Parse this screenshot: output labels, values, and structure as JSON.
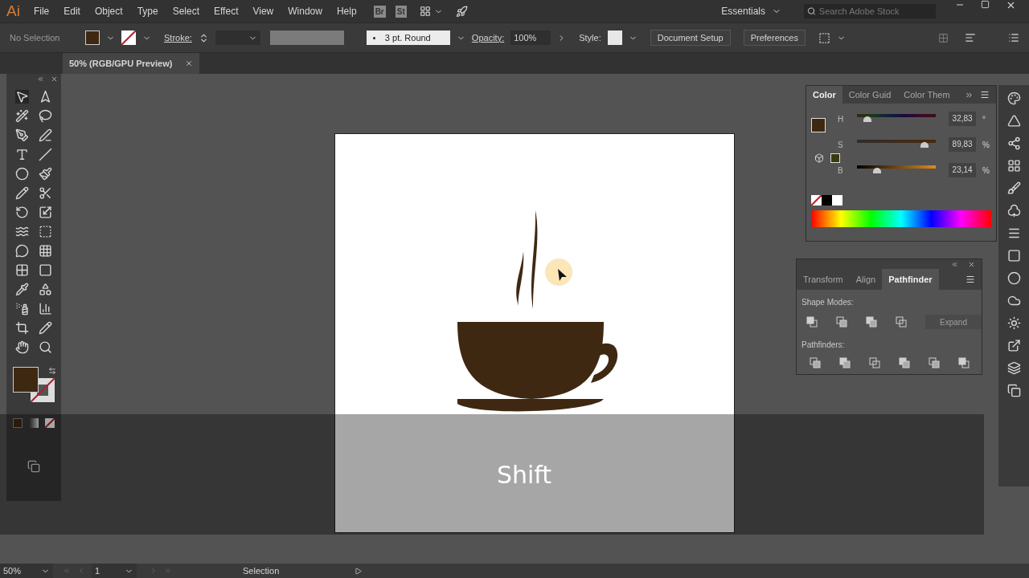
{
  "menu_bar": {
    "app_logo": "Ai",
    "items": [
      "File",
      "Edit",
      "Object",
      "Type",
      "Select",
      "Effect",
      "View",
      "Window",
      "Help"
    ],
    "bridge": "Br",
    "stock": "St",
    "workspace": "Essentials",
    "search": {
      "placeholder": "Search Adobe Stock"
    }
  },
  "control_bar": {
    "selection": "No Selection",
    "stroke_label": "Stroke:",
    "brush": "3 pt. Round",
    "opacity_label": "Opacity:",
    "opacity": "100%",
    "style_label": "Style:",
    "buttons": [
      "Document Setup",
      "Preferences"
    ]
  },
  "document_tab": {
    "title": "50% (RGB/GPU Preview)"
  },
  "color_panel": {
    "tabs": [
      {
        "label": "Color",
        "selected": true
      },
      {
        "label": "Color Guid",
        "selected": false
      },
      {
        "label": "Color Them",
        "selected": false
      }
    ],
    "sliders": [
      {
        "label": "H",
        "level": 0.09,
        "value": "32,83",
        "unit": "°"
      },
      {
        "label": "S",
        "level": 0.9,
        "value": "89,83",
        "unit": "%"
      },
      {
        "label": "B",
        "level": 0.23,
        "value": "23,14",
        "unit": "%"
      }
    ]
  },
  "pathfinder_panel": {
    "tabs": [
      {
        "label": "Transform",
        "selected": false
      },
      {
        "label": "Align",
        "selected": false
      },
      {
        "label": "Pathfinder",
        "selected": true
      }
    ],
    "shape_modes_label": "Shape Modes:",
    "expand": {
      "label": "Expand",
      "disabled": true
    },
    "pathfinders_label": "Pathfinders:"
  },
  "key_overlay": {
    "text": "Shift"
  },
  "status_bar": {
    "zoom": "50%",
    "artboard": "1",
    "tool": "Selection"
  }
}
